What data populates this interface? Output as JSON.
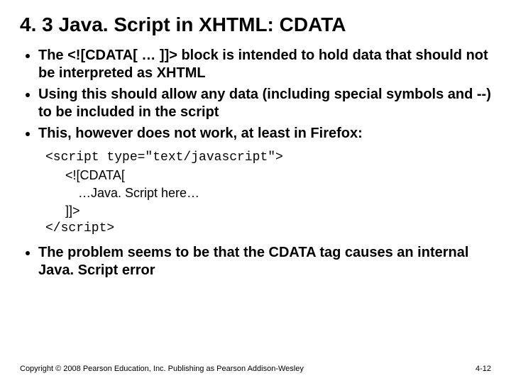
{
  "title": "4. 3 Java. Script in XHTML: CDATA",
  "bullets": {
    "b1": "The <![CDATA[ … ]]>  block is intended to hold data that should not be interpreted as XHTML",
    "b2": "Using this should allow any data (including special symbols and --) to be included in the script",
    "b3": "This, however does not work, at least in Firefox:",
    "b4": "The problem seems to be that the CDATA tag causes an internal Java. Script error"
  },
  "code": {
    "l1": "<script type=\"text/javascript\">",
    "l2": "<![CDATA[",
    "l3": "…Java. Script here…",
    "l4": "]]>",
    "l5": "</script>"
  },
  "footer": {
    "copyright": "Copyright © 2008 Pearson Education, Inc. Publishing as Pearson Addison-Wesley",
    "slide_number": "4-12"
  }
}
